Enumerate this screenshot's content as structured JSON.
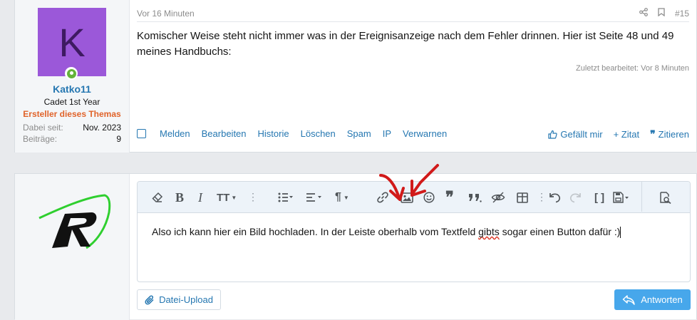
{
  "post": {
    "avatar_letter": "K",
    "username": "Katko11",
    "user_title": "Cadet 1st Year",
    "banner": "Ersteller dieses Themas",
    "stats": [
      {
        "label": "Dabei seit:",
        "value": "Nov. 2023"
      },
      {
        "label": "Beiträge:",
        "value": "9"
      }
    ],
    "time": "Vor 16 Minuten",
    "post_number": "#15",
    "message": "Komischer Weise steht nicht immer was in der Ereignisanzeige nach dem Fehler drinnen. Hier ist Seite 48 und 49 meines Handbuchs:",
    "edited": "Zuletzt bearbeitet: Vor 8 Minuten",
    "actions": [
      "Melden",
      "Bearbeiten",
      "Historie",
      "Löschen",
      "Spam",
      "IP",
      "Verwarnen"
    ],
    "reactions": {
      "like": "Gefällt mir",
      "quote": "+ Zitat",
      "reply_quote": "Zitieren"
    }
  },
  "reply": {
    "content_before": "Also ich kann hier ein Bild hochladen. In der Leiste oberhalb vom Textfeld ",
    "content_misspelled": "gibts",
    "content_after": " sogar einen Button dafür :)",
    "upload_label": "Datei-Upload",
    "submit_label": "Antworten"
  },
  "toolbar_icons": [
    "eraser-icon",
    "bold-icon",
    "italic-icon",
    "font-size-icon",
    "more-icon",
    "list-icon",
    "align-icon",
    "paragraph-icon",
    "link-icon",
    "image-icon",
    "emoji-icon",
    "quote-icon",
    "spoiler-icon",
    "hide-icon",
    "table-icon",
    "more-icon",
    "undo-icon",
    "redo-icon",
    "bbcode-icon",
    "drafts-icon",
    "preview-icon"
  ],
  "colors": {
    "link": "#2577b1",
    "banner": "#e0632a",
    "avatar": "#9b58d9",
    "submit": "#47a7eb",
    "annotation_arrows": "#d11a1a"
  }
}
